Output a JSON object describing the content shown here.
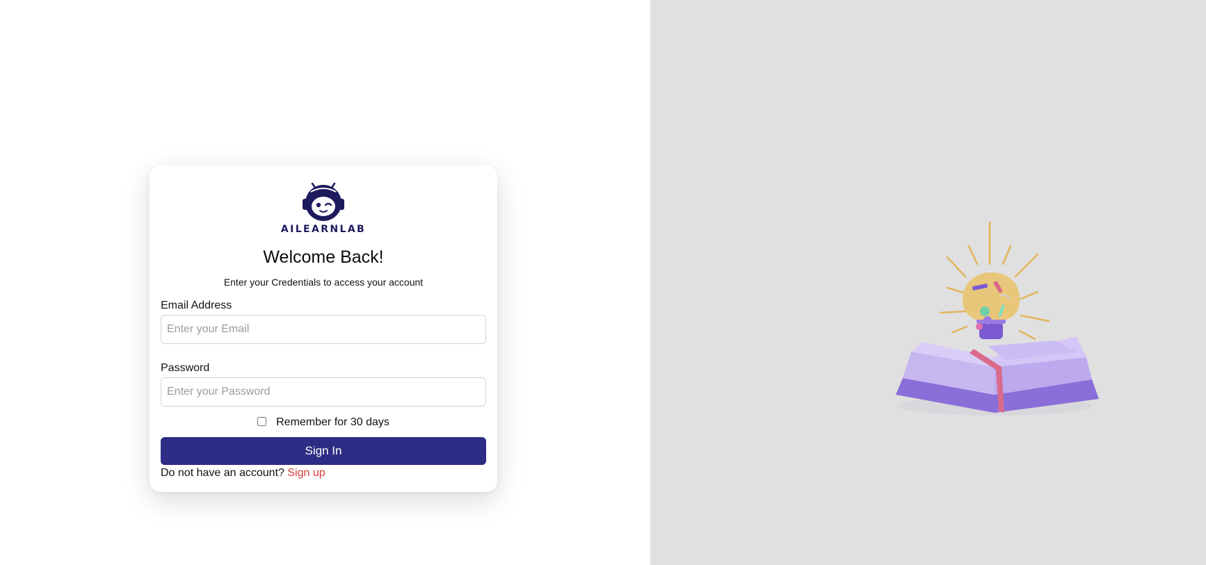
{
  "brand": {
    "name": "AILEARNLAB",
    "color": "#1e1a5e"
  },
  "login": {
    "title": "Welcome Back!",
    "subtitle": "Enter your Credentials to access your account",
    "email": {
      "label": "Email Address",
      "value": "",
      "placeholder": "Enter your Email"
    },
    "password": {
      "label": "Password",
      "value": "",
      "placeholder": "Enter your Password"
    },
    "remember": {
      "label": "Remember for 30 days",
      "checked": false
    },
    "signin_label": "Sign In",
    "signup_prompt": "Do not have an account?",
    "signup_link": "Sign up"
  },
  "colors": {
    "primary_button": "#2e2d85",
    "link": "#d63a3a",
    "right_pane_bg": "#e0e0e0"
  },
  "icons": {
    "logo": "robot-astronaut-icon",
    "hero": "lightbulb-over-open-book-illustration"
  }
}
